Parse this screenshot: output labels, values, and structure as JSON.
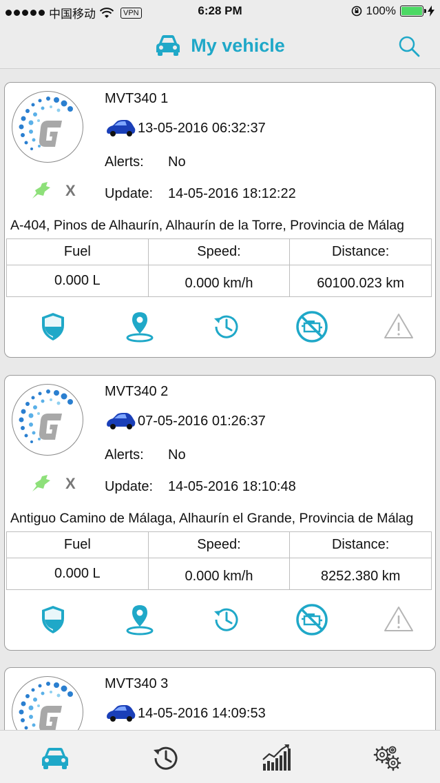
{
  "status_bar": {
    "carrier": "中国移动",
    "vpn": "VPN",
    "time": "6:28 PM",
    "battery": "100%"
  },
  "header": {
    "title": "My vehicle"
  },
  "labels": {
    "alerts": "Alerts:",
    "update": "Update:",
    "fuel": "Fuel",
    "speed": "Speed:",
    "distance": "Distance:",
    "offline_mark": "X"
  },
  "vehicles": [
    {
      "name": "MVT340 1",
      "last_position": "13-05-2016 06:32:37",
      "alerts": "No",
      "update": "14-05-2016 18:12:22",
      "address": "A-404, Pinos de Alhaurín, Alhaurín de la Torre, Provincia de Málag",
      "fuel": "0.000 L",
      "speed": "0.000 km/h",
      "distance": "60100.023 km"
    },
    {
      "name": "MVT340 2",
      "last_position": "07-05-2016 01:26:37",
      "alerts": "No",
      "update": "14-05-2016 18:10:48",
      "address": "Antiguo Camino de Málaga, Alhaurín el Grande, Provincia de Málag",
      "fuel": "0.000 L",
      "speed": "0.000 km/h",
      "distance": "8252.380 km"
    },
    {
      "name": "MVT340 3",
      "last_position": "14-05-2016 14:09:53"
    }
  ],
  "icons": {
    "nav_car": "car-icon",
    "search": "search-icon",
    "shield": "shield-icon",
    "location": "location-pin-icon",
    "history": "history-icon",
    "engine_off": "engine-off-icon",
    "warning": "warning-icon",
    "signal": "gps-signal-icon",
    "tab_vehicles": "car-icon",
    "tab_history": "history-icon",
    "tab_reports": "chart-icon",
    "tab_settings": "gears-icon"
  },
  "colors": {
    "accent": "#1fa8c8",
    "nav_bg": "#ececec",
    "battery": "#4cd964",
    "signal": "#8ee07a",
    "car_blue": "#1a3fb8",
    "warning_gray": "#b5b5b5"
  }
}
